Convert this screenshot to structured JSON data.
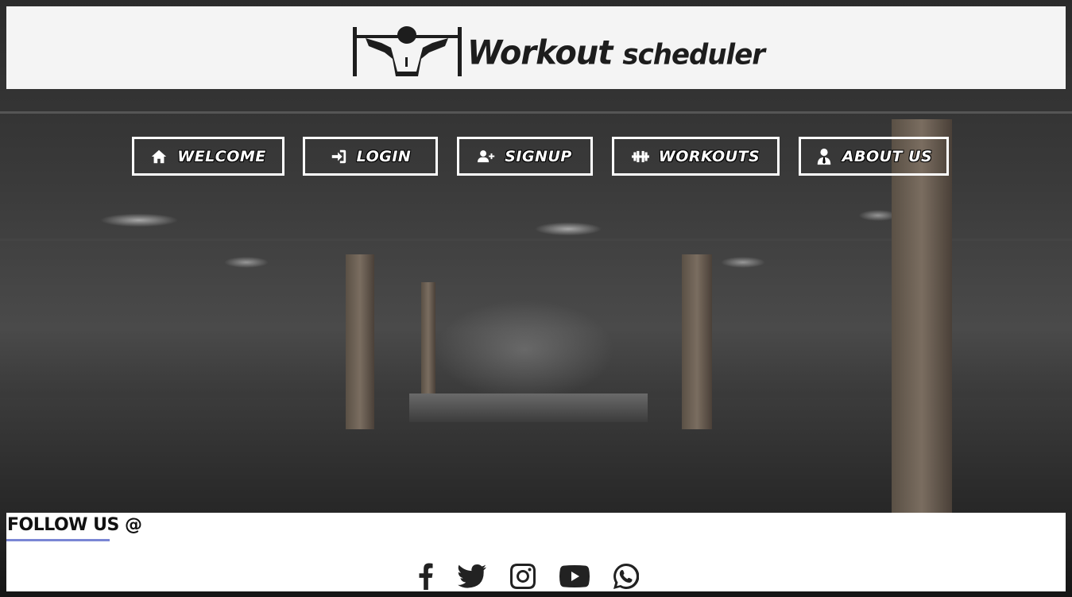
{
  "header": {
    "logo_text_main": "Workout",
    "logo_text_rest": "scheduler"
  },
  "nav": [
    {
      "label": "WELCOME",
      "icon": "home-icon"
    },
    {
      "label": "LOGIN",
      "icon": "sign-in-icon"
    },
    {
      "label": "SIGNUP",
      "icon": "user-plus-icon"
    },
    {
      "label": "WORKOUTS",
      "icon": "dumbbell-icon"
    },
    {
      "label": "ABOUT US",
      "icon": "user-tie-icon"
    }
  ],
  "footer": {
    "follow_label": "FOLLOW US @",
    "accent_color": "#7a86d4",
    "socials": [
      "facebook-icon",
      "twitter-icon",
      "instagram-icon",
      "youtube-icon",
      "whatsapp-icon"
    ]
  }
}
